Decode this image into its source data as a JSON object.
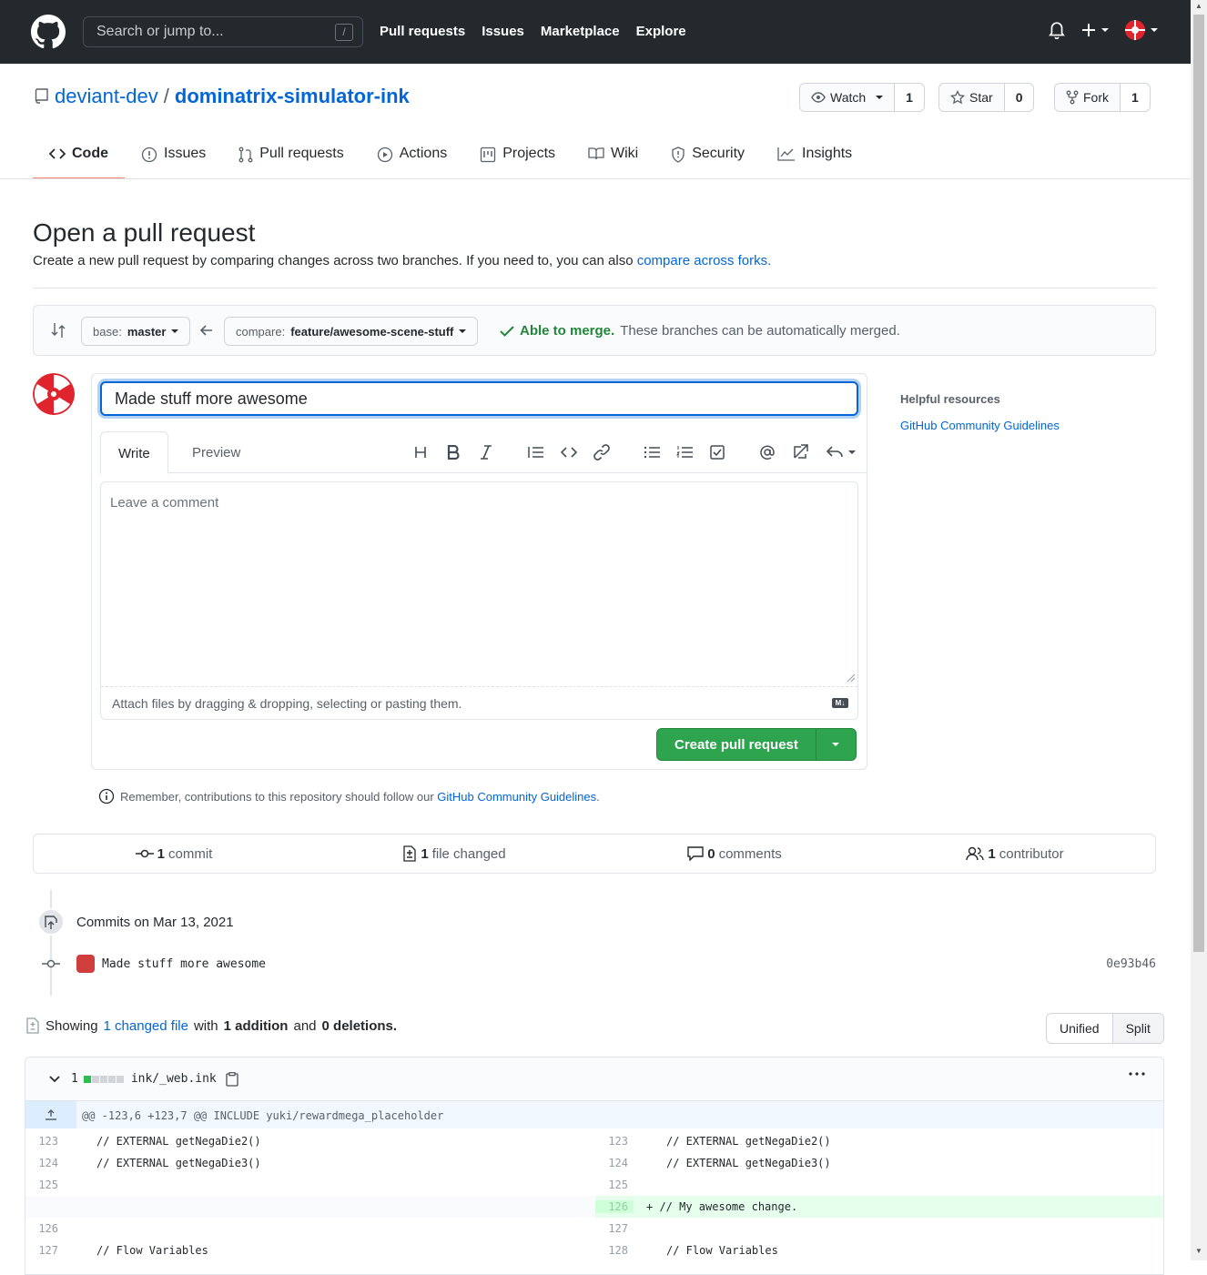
{
  "header": {
    "search_placeholder": "Search or jump to...",
    "search_shortcut": "/",
    "nav": [
      "Pull requests",
      "Issues",
      "Marketplace",
      "Explore"
    ]
  },
  "repo": {
    "owner": "deviant-dev",
    "separator": "/",
    "name": "dominatrix-simulator-ink",
    "watch_label": "Watch",
    "watch_count": "1",
    "star_label": "Star",
    "star_count": "0",
    "fork_label": "Fork",
    "fork_count": "1"
  },
  "tabs": [
    "Code",
    "Issues",
    "Pull requests",
    "Actions",
    "Projects",
    "Wiki",
    "Security",
    "Insights"
  ],
  "page": {
    "title": "Open a pull request",
    "subtitle_prefix": "Create a new pull request by comparing changes across two branches. If you need to, you can also ",
    "subtitle_link": "compare across forks."
  },
  "compare": {
    "base_prefix": "base:",
    "base_branch": "master",
    "compare_prefix": "compare:",
    "compare_branch": "feature/awesome-scene-stuff",
    "merge_ok": "Able to merge.",
    "merge_text": "These branches can be automatically merged."
  },
  "composer": {
    "title_value": "Made stuff more awesome",
    "tab_write": "Write",
    "tab_preview": "Preview",
    "comment_placeholder": "Leave a comment",
    "attach_text": "Attach files by dragging & dropping, selecting or pasting them.",
    "markdown_badge": "M↓",
    "create_label": "Create pull request"
  },
  "remember": {
    "prefix": "Remember, contributions to this repository should follow our ",
    "link": "GitHub Community Guidelines",
    "suffix": "."
  },
  "sidebar": {
    "heading": "Helpful resources",
    "link": "GitHub Community Guidelines"
  },
  "stats": {
    "commits_num": "1",
    "commits_label": "commit",
    "files_num": "1",
    "files_label": "file changed",
    "comments_num": "0",
    "comments_label": "comments",
    "contributors_num": "1",
    "contributors_label": "contributor"
  },
  "commits": {
    "heading": "Commits on Mar 13, 2021",
    "items": [
      {
        "message": "Made stuff more awesome",
        "sha": "0e93b46"
      }
    ]
  },
  "summary": {
    "prefix": "Showing",
    "link": "1 changed file",
    "with": "with",
    "additions": "1 addition",
    "and": "and",
    "deletions": "0 deletions."
  },
  "view": {
    "unified": "Unified",
    "split": "Split"
  },
  "diff": {
    "changed_count": "1",
    "filename": "ink/_web.ink",
    "hunk": "@@ -123,6 +123,7 @@ INCLUDE yuki/rewardmega_placeholder",
    "left": [
      {
        "n": "123",
        "code": "// EXTERNAL getNegaDie2()"
      },
      {
        "n": "124",
        "code": "// EXTERNAL getNegaDie3()"
      },
      {
        "n": "125",
        "code": ""
      },
      {
        "n": "126",
        "code": ""
      },
      {
        "n": "127",
        "code": "// Flow Variables"
      }
    ],
    "right": [
      {
        "n": "123",
        "code": "// EXTERNAL getNegaDie2()"
      },
      {
        "n": "124",
        "code": "// EXTERNAL getNegaDie3()"
      },
      {
        "n": "125",
        "code": ""
      },
      {
        "n": "126",
        "code": "+ // My awesome change."
      },
      {
        "n": "127",
        "code": ""
      },
      {
        "n": "128",
        "code": "// Flow Variables"
      }
    ]
  },
  "colors": {
    "accent": "#0366d6",
    "green": "#2ea44f",
    "header_bg": "#24292e",
    "tab_underline": "#f9826c"
  }
}
